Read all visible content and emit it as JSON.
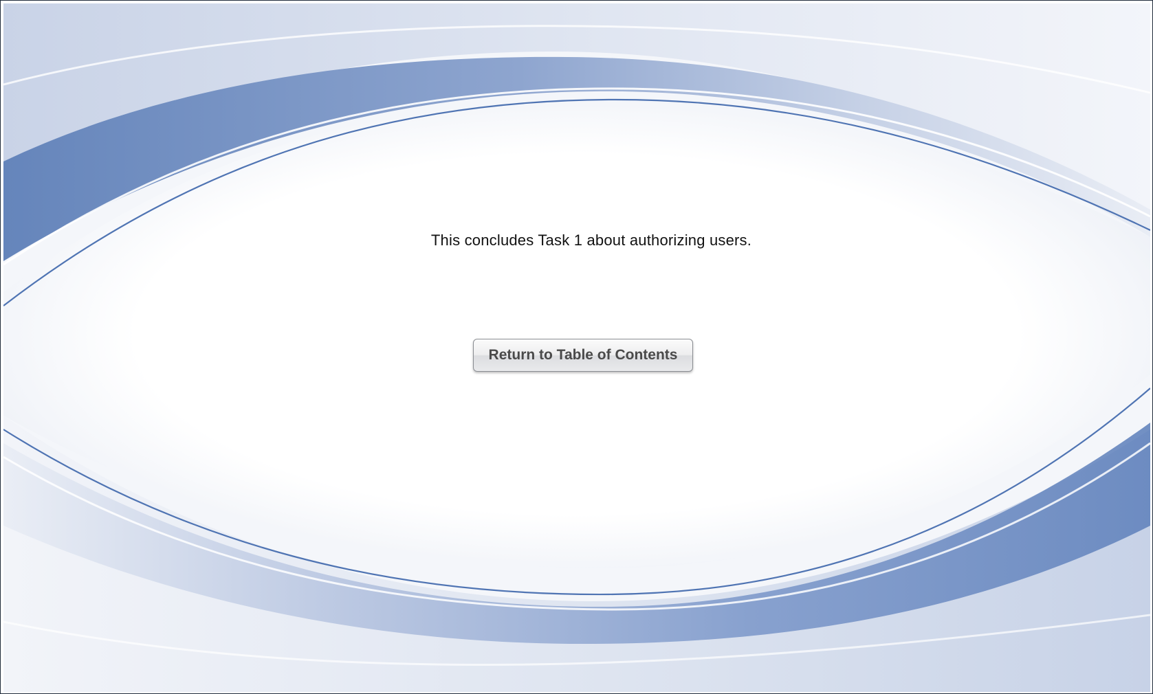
{
  "page": {
    "message": "This concludes Task 1 about authorizing users.",
    "return_button_label": "Return to Table of Contents"
  },
  "colors": {
    "band_dark": "#6f8ebf",
    "band_mid": "#9fb1d2",
    "band_light": "#d4dcec",
    "line_blue": "#4f74b3",
    "frame_border": "#1f2a3a",
    "button_text": "#4a4a4a"
  }
}
